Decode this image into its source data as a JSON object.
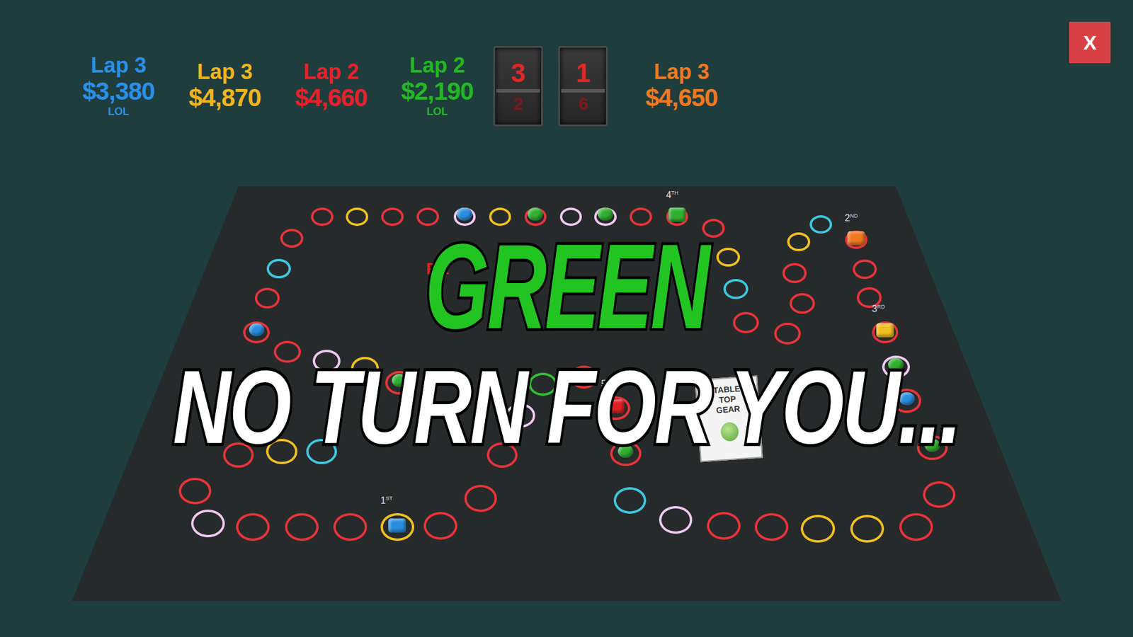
{
  "scoreboard": {
    "players_before_dice": [
      {
        "lap": "Lap 3",
        "money": "$3,380",
        "note": "LOL",
        "color": "#2a8ee8"
      },
      {
        "lap": "Lap 3",
        "money": "$4,870",
        "note": "",
        "color": "#f2b41e"
      },
      {
        "lap": "Lap 2",
        "money": "$4,660",
        "note": "",
        "color": "#e8202a"
      },
      {
        "lap": "Lap 2",
        "money": "$2,190",
        "note": "LOL",
        "color": "#22b822"
      }
    ],
    "dice": [
      {
        "top": "3",
        "bottom": "2"
      },
      {
        "top": "1",
        "bottom": "6"
      }
    ],
    "players_after_dice": [
      {
        "lap": "Lap 3",
        "money": "$4,650",
        "note": "",
        "color": "#f07820"
      }
    ]
  },
  "close_button": "X",
  "board": {
    "label": "RE",
    "card": {
      "title": "TABLE TOP GEAR"
    },
    "spaces": [
      {
        "color": "#e8333a",
        "piece": null
      },
      {
        "color": "#f0c020",
        "piece": null
      },
      {
        "color": "#e8333a",
        "piece": null
      },
      {
        "color": "#e8333a",
        "piece": null
      },
      {
        "color": "#f0c8f0",
        "piece": {
          "kind": "pawn",
          "color": "#2a8ee0"
        }
      },
      {
        "color": "#f0c020",
        "piece": null
      },
      {
        "color": "#e8333a",
        "piece": {
          "kind": "pawn",
          "color": "#30b030"
        }
      },
      {
        "color": "#f0c8f0",
        "piece": null
      },
      {
        "color": "#f0c8f0",
        "piece": {
          "kind": "pawn",
          "color": "#30b030"
        }
      },
      {
        "color": "#e8333a",
        "piece": null
      },
      {
        "color": "#e8333a",
        "piece": {
          "kind": "car",
          "color": "#30b030",
          "place": "4",
          "suffix": "TH"
        }
      },
      {
        "color": "#e8333a",
        "piece": null
      },
      {
        "color": "#f0c020",
        "piece": null
      },
      {
        "color": "#3cc8e0",
        "piece": null
      },
      {
        "color": "#e8333a",
        "piece": null
      },
      {
        "color": "#e8333a",
        "piece": null
      },
      {
        "color": "#e8333a",
        "piece": null
      },
      {
        "color": "#e8333a",
        "piece": null
      },
      {
        "color": "#f0c020",
        "piece": null
      },
      {
        "color": "#3cc8e0",
        "piece": null
      },
      {
        "color": "#e8333a",
        "piece": {
          "kind": "car",
          "color": "#f07820",
          "place": "2",
          "suffix": "ND"
        }
      },
      {
        "color": "#e8333a",
        "piece": null
      },
      {
        "color": "#e8333a",
        "piece": null
      },
      {
        "color": "#e8333a",
        "piece": {
          "kind": "car",
          "color": "#f0c020",
          "place": "3",
          "suffix": "RD"
        }
      },
      {
        "color": "#f0c8f0",
        "piece": {
          "kind": "pawn",
          "color": "#30b030"
        }
      },
      {
        "color": "#e8333a",
        "piece": {
          "kind": "pawn",
          "color": "#2a8ee0"
        }
      },
      {
        "color": "#e8333a",
        "piece": {
          "kind": "pawn",
          "color": "#30b030"
        }
      },
      {
        "color": "#e8333a",
        "piece": null
      },
      {
        "color": "#e8333a",
        "piece": null
      },
      {
        "color": "#f0c020",
        "piece": null
      },
      {
        "color": "#f0c020",
        "piece": null
      },
      {
        "color": "#e8333a",
        "piece": null
      },
      {
        "color": "#e8333a",
        "piece": null
      },
      {
        "color": "#f0c8f0",
        "piece": null
      },
      {
        "color": "#3cc8e0",
        "piece": null
      },
      {
        "color": "#e8333a",
        "piece": {
          "kind": "pawn",
          "color": "#30b030"
        }
      },
      {
        "color": "#e8333a",
        "piece": {
          "kind": "car",
          "color": "#e02020",
          "place": "5",
          "suffix": "TH"
        }
      },
      {
        "color": "#e8333a",
        "piece": null
      },
      {
        "color": "#30c030",
        "piece": null
      },
      {
        "color": "#f0c8f0",
        "piece": null
      },
      {
        "color": "#e8333a",
        "piece": null
      },
      {
        "color": "#e8333a",
        "piece": null
      },
      {
        "color": "#e8333a",
        "piece": null
      },
      {
        "color": "#f0c020",
        "piece": {
          "kind": "car",
          "color": "#2a8ee0",
          "place": "1",
          "suffix": "ST"
        }
      },
      {
        "color": "#e8333a",
        "piece": null
      },
      {
        "color": "#e8333a",
        "piece": null
      },
      {
        "color": "#e8333a",
        "piece": null
      },
      {
        "color": "#f0c8f0",
        "piece": null
      },
      {
        "color": "#e8333a",
        "piece": null
      },
      {
        "color": "#e8333a",
        "piece": null
      },
      {
        "color": "#f0c020",
        "piece": null
      },
      {
        "color": "#3cc8e0",
        "piece": null
      },
      {
        "color": "#e8333a",
        "piece": {
          "kind": "pawn",
          "color": "#30b030"
        }
      },
      {
        "color": "#f0c020",
        "piece": null
      },
      {
        "color": "#f0c8f0",
        "piece": null
      },
      {
        "color": "#e8333a",
        "piece": null
      },
      {
        "color": "#e8333a",
        "piece": {
          "kind": "pawn",
          "color": "#2a8ee0"
        }
      },
      {
        "color": "#e8333a",
        "piece": null
      },
      {
        "color": "#3cc8e0",
        "piece": null
      },
      {
        "color": "#e8333a",
        "piece": null
      }
    ]
  },
  "overlay": {
    "player": "GREEN",
    "player_color": "#22c422",
    "message": "NO TURN FOR YOU..."
  }
}
